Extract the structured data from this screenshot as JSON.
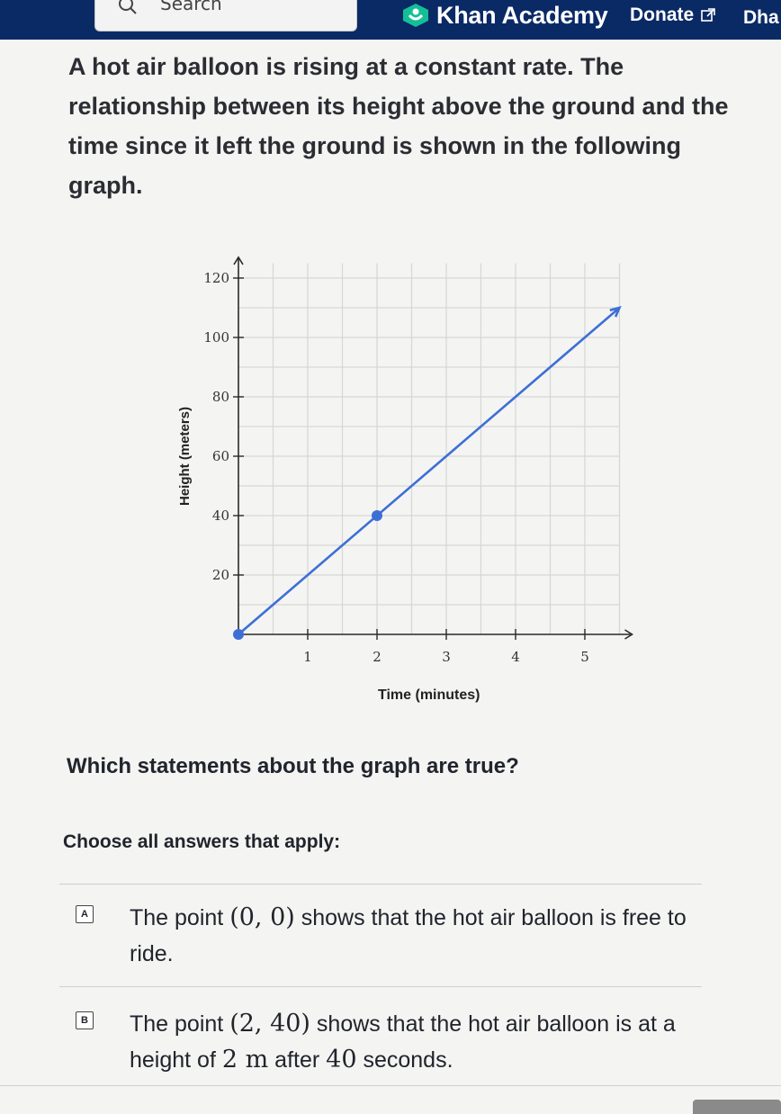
{
  "header": {
    "search_placeholder": "Search",
    "brand": "Khan Academy",
    "donate_label": "Donate",
    "user_label": "Dha"
  },
  "question": {
    "text": "A hot air balloon is rising at a constant rate. The relationship between its height above the ground and the time since it left the ground is shown in the following graph."
  },
  "chart_data": {
    "type": "line",
    "xlabel": "Time (minutes)",
    "ylabel": "Height (meters)",
    "xlim": [
      0,
      5.5
    ],
    "ylim": [
      0,
      120
    ],
    "x_ticks": [
      1,
      2,
      3,
      4,
      5
    ],
    "y_ticks": [
      20,
      40,
      60,
      80,
      100,
      120
    ],
    "grid": true,
    "series": [
      {
        "x": [
          0,
          5.5
        ],
        "y": [
          0,
          110
        ],
        "color": "#3c6fd6"
      }
    ],
    "highlighted_points": [
      {
        "x": 0,
        "y": 0
      },
      {
        "x": 2,
        "y": 40
      }
    ]
  },
  "prompt": "Which statements about the graph are true?",
  "instructions": "Choose all answers that apply:",
  "choices": [
    {
      "letter": "A",
      "text_before": "The point ",
      "math": "(0, 0)",
      "text_after": " shows that the hot air balloon is free to ride."
    },
    {
      "letter": "B",
      "text_before": "The point ",
      "math": "(2, 40)",
      "text_mid": " shows that the hot air balloon is at a height of ",
      "math2": "2 m",
      "text_mid2": " after ",
      "math3": "40",
      "text_after": " seconds."
    }
  ]
}
